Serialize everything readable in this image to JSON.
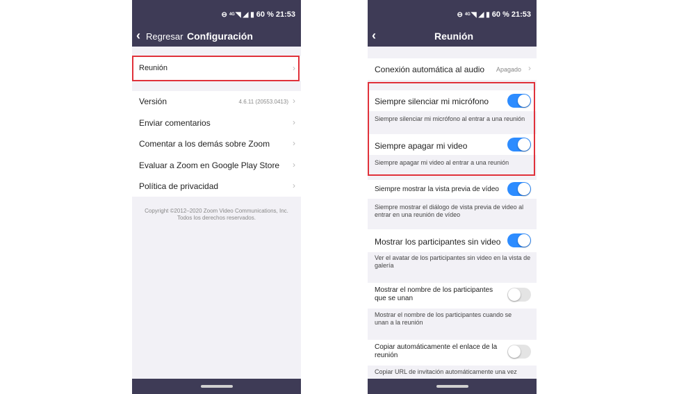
{
  "status": {
    "battery": "60 %",
    "time": "21:53",
    "network": "4G"
  },
  "left": {
    "back_label": "Regresar",
    "title": "Configuración",
    "items": [
      {
        "label": "Reunión",
        "value": ""
      },
      {
        "label": "Versión",
        "value": "4.6.11 (20553.0413)"
      },
      {
        "label": "Enviar comentarios",
        "value": ""
      },
      {
        "label": "Comentar a los demás sobre Zoom",
        "value": ""
      },
      {
        "label": "Evaluar a Zoom en Google Play Store",
        "value": ""
      },
      {
        "label": "Política de privacidad",
        "value": ""
      }
    ],
    "footer_line1": "Copyright ©2012–2020 Zoom Video Communications, Inc.",
    "footer_line2": "Todos los derechos reservados."
  },
  "right": {
    "title": "Reunión",
    "audio": {
      "label": "Conexión automática al audio",
      "value": "Apagado"
    },
    "settings": [
      {
        "label": "Siempre silenciar mi micrófono",
        "desc": "Siempre silenciar mi micrófono al entrar a una reunión",
        "enabled": true
      },
      {
        "label": "Siempre apagar mi video",
        "desc": "Siempre apagar mi video al entrar a una reunión",
        "enabled": true
      },
      {
        "label": "Siempre mostrar la vista previa de vídeo",
        "desc": "Siempre mostrar el diálogo de vista previa de video al entrar en una reunión de vídeo",
        "enabled": true
      },
      {
        "label": "Mostrar los participantes sin video",
        "desc": "Ver el avatar de los participantes sin video en la vista de galería",
        "enabled": true
      },
      {
        "label": "Mostrar el nombre de los participantes que se unan",
        "desc": "Mostrar el nombre de los participantes cuando se unan a la reunión",
        "enabled": false
      },
      {
        "label": "Copiar automáticamente el enlace de la reunión",
        "desc": "Copiar URL de invitación automáticamente una vez",
        "enabled": false
      }
    ]
  },
  "colors": {
    "header": "#3e3b56",
    "toggle_on": "#2d8cff",
    "highlight": "#e0313a"
  }
}
